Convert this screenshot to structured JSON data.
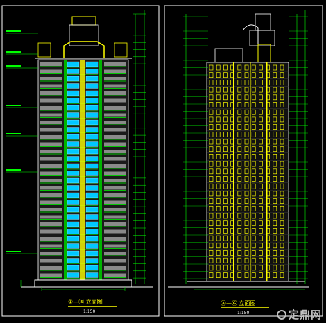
{
  "drawing": {
    "left_sheet": {
      "title": "①—⑮ 立面图",
      "scale": "1:150"
    },
    "right_sheet": {
      "title": "Ⓐ—Ⓖ 立面图",
      "scale": "1:150"
    }
  },
  "watermark": {
    "text": "定鼎网",
    "url_part": "NET"
  },
  "colors": {
    "background": "#000000",
    "frame": "#ffffff",
    "green_line": "#00ff00",
    "cyan_glass": "#00c8ff",
    "yellow_window": "#ffff00",
    "grey_block": "#8a8a8a",
    "dim_text": "#00ff00"
  }
}
